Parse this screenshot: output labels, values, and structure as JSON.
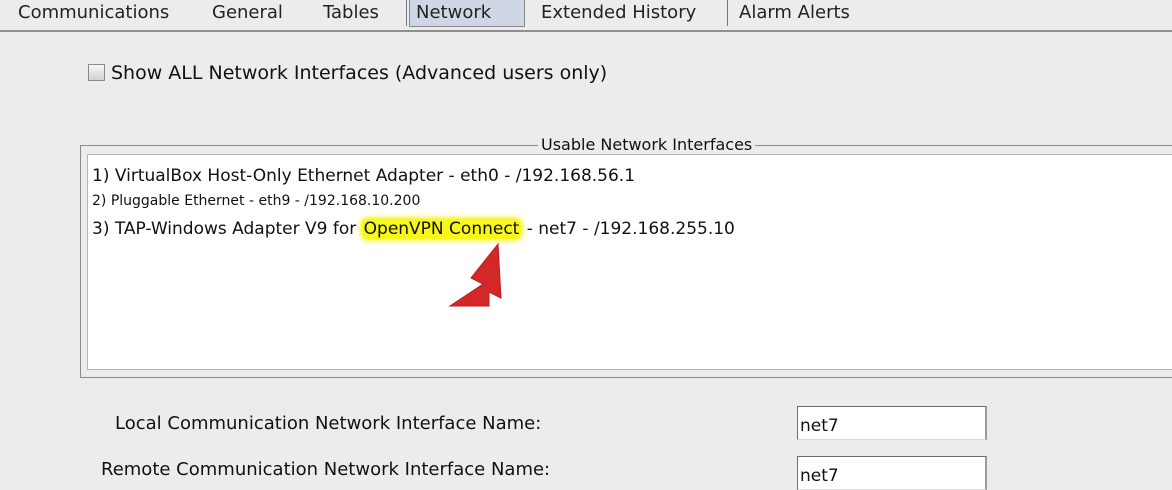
{
  "tabs": [
    {
      "label": "Communications",
      "active": false
    },
    {
      "label": "General",
      "active": false
    },
    {
      "label": "Tables",
      "active": false
    },
    {
      "label": "Network",
      "active": true
    },
    {
      "label": "Extended History",
      "active": false
    },
    {
      "label": "Alarm Alerts",
      "active": false
    }
  ],
  "checkbox": {
    "label": "Show ALL Network Interfaces (Advanced users only)",
    "checked": false
  },
  "group": {
    "title": "Usable Network Interfaces",
    "items": [
      {
        "text": "1) VirtualBox Host-Only Ethernet Adapter  - eth0 - /192.168.56.1"
      },
      {
        "text": "2) Pluggable Ethernet  - eth9 - /192.168.10.200"
      },
      {
        "before": "3) TAP-Windows Adapter V9 for ",
        "highlight": "OpenVPN Connect",
        "after": "  - net7 - /192.168.255.10"
      }
    ]
  },
  "annotation": {
    "highlight_color": "#f7f719",
    "arrow_color": "#d42828"
  },
  "fields": {
    "local": {
      "label": "Local Communication Network Interface Name:",
      "value": "net7"
    },
    "remote": {
      "label": "Remote Communication Network Interface Name:",
      "value": "net7"
    }
  }
}
